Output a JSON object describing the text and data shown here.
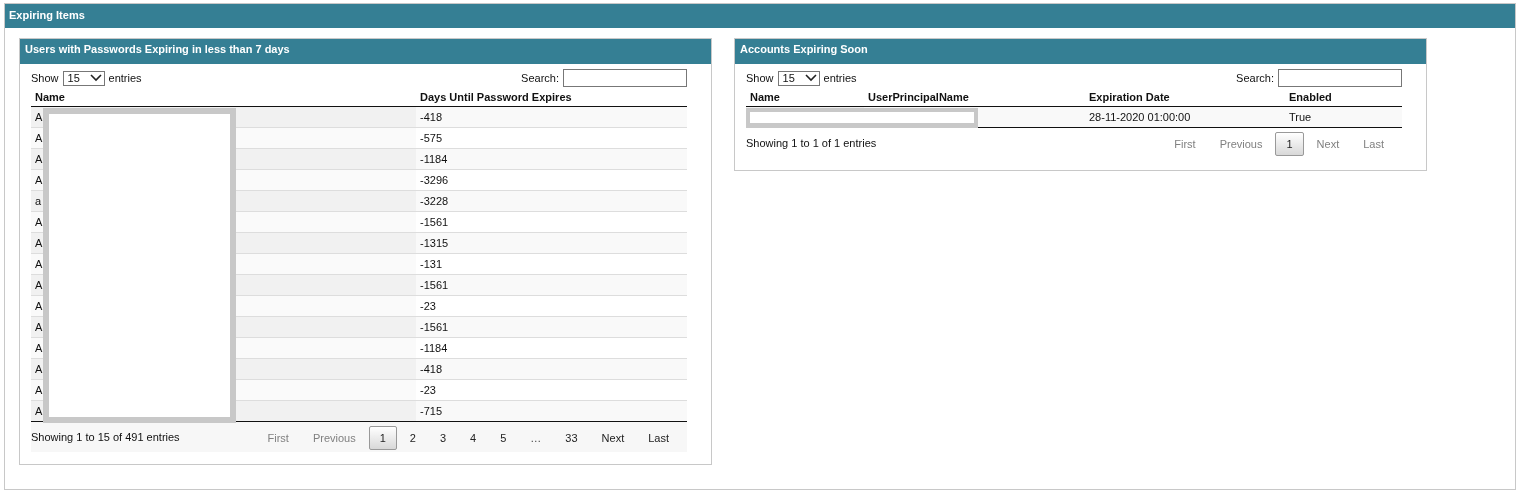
{
  "section": {
    "title": "Expiring Items"
  },
  "panels": [
    {
      "title": "Users with Passwords Expiring in less than 7 days",
      "redacted": true,
      "length": {
        "before": "Show",
        "value": "15",
        "after": "entries"
      },
      "search": {
        "label": "Search:"
      },
      "columns": [
        "Name",
        "Days Until Password Expires"
      ],
      "rows": [
        [
          "A",
          "-418"
        ],
        [
          "A",
          "-575"
        ],
        [
          "A",
          "-1184"
        ],
        [
          "A",
          "-3296"
        ],
        [
          "a",
          "-3228"
        ],
        [
          "A",
          "-1561"
        ],
        [
          "A",
          "-1315"
        ],
        [
          "A",
          "-131"
        ],
        [
          "A",
          "-1561"
        ],
        [
          "A",
          "-23"
        ],
        [
          "A",
          "-1561"
        ],
        [
          "A",
          "-1184"
        ],
        [
          "A",
          "-418"
        ],
        [
          "A",
          "-23"
        ],
        [
          "A",
          "-715"
        ]
      ],
      "info": "Showing 1 to 15 of 491 entries",
      "pagination": [
        {
          "label": "First",
          "kind": "link",
          "disabled": true,
          "selected": false
        },
        {
          "label": "Previous",
          "kind": "link",
          "disabled": true,
          "selected": false
        },
        {
          "label": "1",
          "kind": "link",
          "disabled": false,
          "selected": true
        },
        {
          "label": "2",
          "kind": "link",
          "disabled": false,
          "selected": false
        },
        {
          "label": "3",
          "kind": "link",
          "disabled": false,
          "selected": false
        },
        {
          "label": "4",
          "kind": "link",
          "disabled": false,
          "selected": false
        },
        {
          "label": "5",
          "kind": "link",
          "disabled": false,
          "selected": false
        },
        {
          "label": "…",
          "kind": "ellipsis"
        },
        {
          "label": "33",
          "kind": "link",
          "disabled": false,
          "selected": false
        },
        {
          "label": "Next",
          "kind": "link",
          "disabled": false,
          "selected": false
        },
        {
          "label": "Last",
          "kind": "link",
          "disabled": false,
          "selected": false
        }
      ]
    },
    {
      "title": "Accounts Expiring Soon",
      "redacted": true,
      "length": {
        "before": "Show",
        "value": "15",
        "after": "entries"
      },
      "search": {
        "label": "Search:"
      },
      "columns": [
        "Name",
        "UserPrincipalName",
        "Expiration Date",
        "Enabled"
      ],
      "rows": [
        [
          "",
          "",
          "28-11-2020 01:00:00",
          "True"
        ]
      ],
      "info": "Showing 1 to 1 of 1 entries",
      "pagination": [
        {
          "label": "First",
          "kind": "link",
          "disabled": true,
          "selected": false
        },
        {
          "label": "Previous",
          "kind": "link",
          "disabled": true,
          "selected": false
        },
        {
          "label": "1",
          "kind": "link",
          "disabled": false,
          "selected": true
        },
        {
          "label": "Next",
          "kind": "link",
          "disabled": true,
          "selected": false
        },
        {
          "label": "Last",
          "kind": "link",
          "disabled": true,
          "selected": false
        }
      ]
    }
  ]
}
